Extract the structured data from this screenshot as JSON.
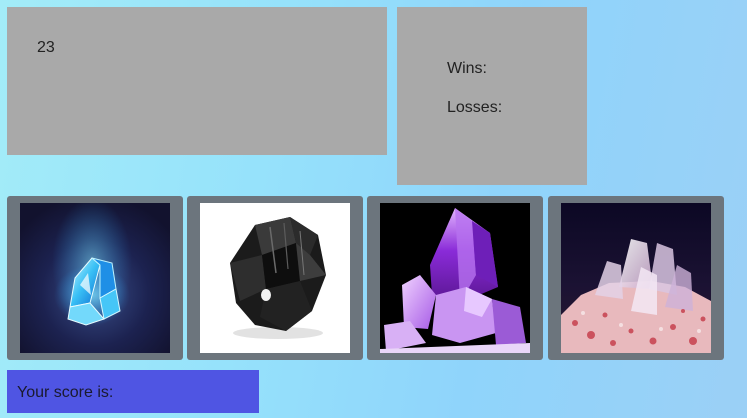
{
  "target": {
    "number": "23"
  },
  "stats": {
    "wins_label": "Wins:",
    "losses_label": "Losses:"
  },
  "crystals": [
    {
      "icon": "blue-glowing-crystal-icon"
    },
    {
      "icon": "black-tourmaline-crystal-icon"
    },
    {
      "icon": "amethyst-crystal-icon"
    },
    {
      "icon": "pink-salt-quartz-crystal-icon"
    }
  ],
  "score": {
    "label": "Your score is:"
  },
  "colors": {
    "panel": "#a9a9a9",
    "card": "#6c757d",
    "score_box": "#4f55e3"
  }
}
